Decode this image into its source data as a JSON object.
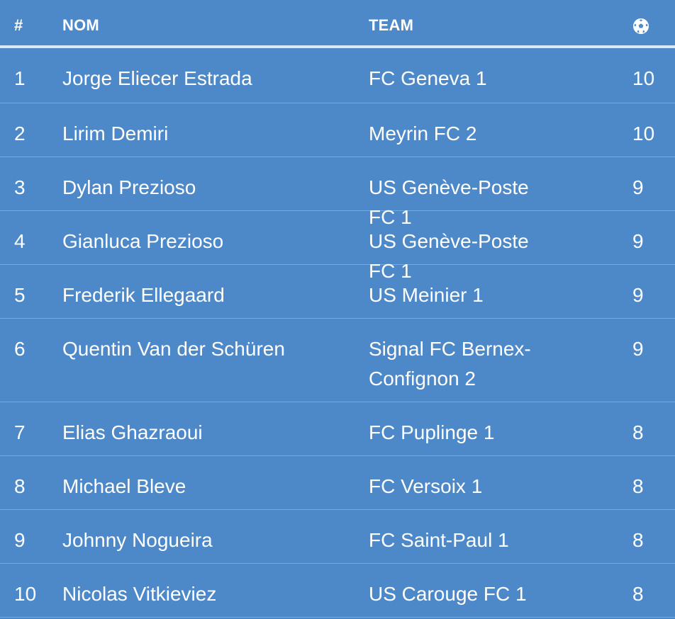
{
  "header": {
    "rank": "#",
    "name": "NOM",
    "team": "TEAM",
    "goals_icon": "soccer-ball-icon"
  },
  "rows": [
    {
      "rank": "1",
      "name": "Jorge Eliecer Estrada",
      "team": "FC Geneva 1",
      "goals": "10"
    },
    {
      "rank": "2",
      "name": "Lirim Demiri",
      "team": "Meyrin FC 2",
      "goals": "10"
    },
    {
      "rank": "3",
      "name": "Dylan Prezioso",
      "team": "US Genève-Poste FC 1",
      "goals": "9"
    },
    {
      "rank": "4",
      "name": "Gianluca Prezioso",
      "team": "US Genève-Poste FC 1",
      "goals": "9"
    },
    {
      "rank": "5",
      "name": "Frederik Ellegaard",
      "team": "US Meinier 1",
      "goals": "9"
    },
    {
      "rank": "6",
      "name": "Quentin Van der Schüren",
      "team": "Signal FC Bernex-Confignon 2",
      "goals": "9"
    },
    {
      "rank": "7",
      "name": "Elias Ghazraoui",
      "team": "FC Puplinge 1",
      "goals": "8"
    },
    {
      "rank": "8",
      "name": "Michael Bleve",
      "team": "FC Versoix 1",
      "goals": "8"
    },
    {
      "rank": "9",
      "name": "Johnny Nogueira",
      "team": "FC Saint-Paul 1",
      "goals": "8"
    },
    {
      "rank": "10",
      "name": "Nicolas Vitkieviez",
      "team": "US Carouge FC 1",
      "goals": "8"
    }
  ],
  "colors": {
    "background": "#4d89c9",
    "text": "#ffffff",
    "header_rule": "#dde7f2",
    "row_divider": "#7aa8d8"
  }
}
